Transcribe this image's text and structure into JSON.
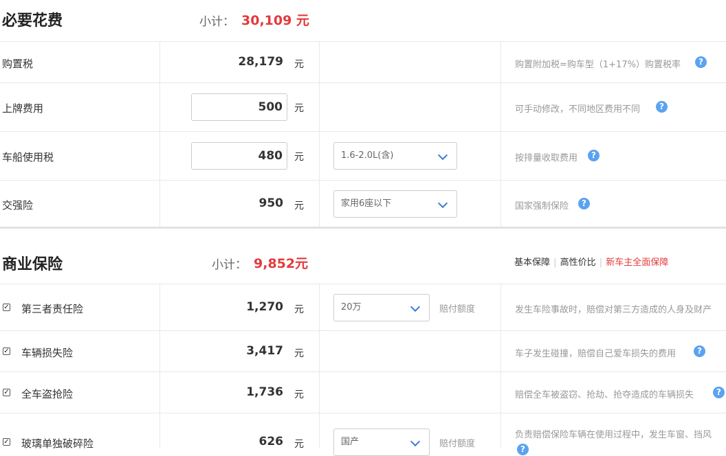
{
  "required": {
    "title": "必要花费",
    "subtotal_label": "小计：",
    "subtotal_value": "30,109 元",
    "rows": [
      {
        "label": "购置税",
        "amount": "28,179",
        "unit": "元",
        "note": "购置附加税=购车型（1+17%）购置税率"
      },
      {
        "label": "上牌费用",
        "amount": "500",
        "unit": "元",
        "note": "可手动修改，不同地区费用不同"
      },
      {
        "label": "车船使用税",
        "amount": "480",
        "unit": "元",
        "select": "1.6-2.0L(含)",
        "note": "按排量收取费用"
      },
      {
        "label": "交强险",
        "amount": "950",
        "unit": "元",
        "select": "家用6座以下",
        "note": "国家强制保险"
      }
    ]
  },
  "commercial": {
    "title": "商业保险",
    "subtotal_label": "小计：",
    "subtotal_value": "9,852元",
    "plans": [
      "基本保障",
      "高性价比",
      "新车主全面保障"
    ],
    "rows": [
      {
        "label": "第三者责任险",
        "amount": "1,270",
        "unit": "元",
        "checked": true,
        "select": "20万",
        "select_label": "赔付额度",
        "note": "发生车险事故时，赔偿对第三方造成的人身及财产"
      },
      {
        "label": "车辆损失险",
        "amount": "3,417",
        "unit": "元",
        "checked": true,
        "note": "车子发生碰撞，赔偿自己爱车损失的费用"
      },
      {
        "label": "全车盗抢险",
        "amount": "1,736",
        "unit": "元",
        "checked": true,
        "note": "赔偿全车被盗窃、抢劫、抢夺造成的车辆损失"
      },
      {
        "label": "玻璃单独破碎险",
        "amount": "626",
        "unit": "元",
        "checked": true,
        "select": "国产",
        "select_label": "赔付额度",
        "note": "负责赔偿保险车辆在使用过程中，发生车窗、挡风"
      }
    ]
  },
  "icons": {
    "help": "question-circle-icon",
    "dropdown": "chevron-down-icon",
    "check": "checkbox-checked-icon"
  },
  "colors": {
    "accent": "#e4393c",
    "help": "#5aa3f0",
    "chevron": "#3b7dd8"
  }
}
